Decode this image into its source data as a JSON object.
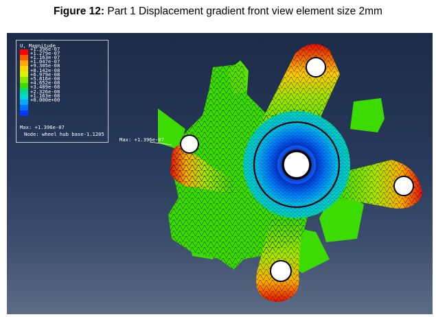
{
  "caption": {
    "label": "Figure 12:",
    "text": " Part 1 Displacement gradient front view element size 2mm"
  },
  "legend": {
    "title": "U, Magnitude",
    "values": [
      "+1.396e-07",
      "+1.279e-07",
      "+1.163e-07",
      "+1.047e-07",
      "+9.305e-08",
      "+8.142e-08",
      "+6.979e-08",
      "+5.816e-08",
      "+4.652e-08",
      "+3.489e-08",
      "+2.326e-08",
      "+1.163e-08",
      "+0.000e+00"
    ],
    "colors": [
      "#ff0000",
      "#ff5a00",
      "#ffa800",
      "#ffd500",
      "#d8f200",
      "#8ee600",
      "#3ddc00",
      "#00d890",
      "#00d8d0",
      "#00a8ff",
      "#0070ff",
      "#0038ff",
      "#0000c8"
    ],
    "max_text": "Max: +1.396e-07",
    "node_text": "Node: wheel hub base-1.1205"
  },
  "viewport": {
    "max_marker_text": "Max: +1.396e-07",
    "background_top": "#1c2b47",
    "background_bottom": "#5d6c86"
  }
}
